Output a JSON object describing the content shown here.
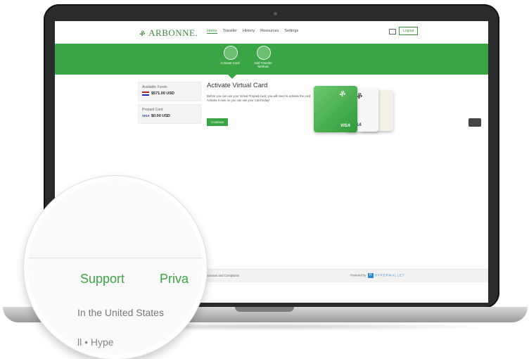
{
  "nav": {
    "logo": "ARBONNE.",
    "links": [
      "Home",
      "Transfer",
      "History",
      "Resources",
      "Settings"
    ],
    "logout": "Logout"
  },
  "actions": [
    {
      "label": "Activate Card"
    },
    {
      "label": "Add Transfer Method"
    }
  ],
  "funds": {
    "available_label": "Available Funds",
    "available_value": "$571.00 USD",
    "prepaid_label": "Prepaid Card",
    "prepaid_value": "$0.00 USD",
    "visa_text": "VISA"
  },
  "activate": {
    "title": "Activate Virtual Card",
    "description": "Before you can use your Virtual Prepaid Card, you will need to activate the card. Activate it now, so you can use your Card today!",
    "button": "Continue"
  },
  "card_brand": "VISA",
  "footer": {
    "links": "Support    Privacy Policy    Licenses and Complaints",
    "powered_by": "Powered by",
    "hyperwallet": "HYPERWALLET"
  },
  "magnifier": {
    "support": "Support",
    "privacy": "Priva",
    "us_text": "In the United States",
    "hype_text": "ll • Hype"
  }
}
